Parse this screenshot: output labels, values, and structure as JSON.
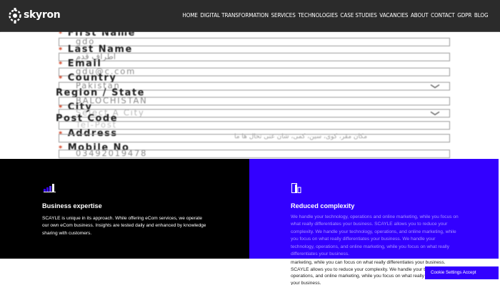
{
  "header": {
    "logo_text": "skyron",
    "nav": [
      "HOME",
      "DIGITAL TRANSFORMATION",
      "SERVICES",
      "TECHNOLOGIES",
      "CASE STUDIES",
      "VACANCIES",
      "ABOUT",
      "CONTACT",
      "GDPR",
      "BLOG"
    ]
  },
  "form": {
    "first_name_label": "First Name",
    "first_name_value": "gdo",
    "last_name_label": "Last Name",
    "last_name_value": "اطراف قدم",
    "email_label": "Email",
    "email_value": "gdu@c.com",
    "country_label": "Country",
    "country_value": "Pakistan",
    "region_label": "Region / State",
    "region_value": "BALOCHISTAN",
    "city_label": "City",
    "city_value": "Select A City",
    "postcode_label": "Post Code",
    "postcode_value": "Tel-Post",
    "address_label": "Address",
    "address_value": "مکان مقر، کوی، سین، کمی، شان عنی تحال ها ما",
    "mobile_label": "Mobile No",
    "mobile_value": "03492019478"
  },
  "features": {
    "left_title": "Business expertise",
    "left_text": "SCAYLE is unique in its approach. While offering eCom services, we operate our own eCom business. Insights are tested daily and enhanced by knowledge sharing with customers.",
    "right_title": "Reduced complexity",
    "right_text": "We handle your technology, operations and online marketing, while you focus on what really differentiates your business. SCAYLE allows you to reduce your complexity. We handle your technology, operations, and online marketing, while you focus on what really differentiates your business. We handle your technology, operations, and online marketing, while you focus on what really differentiates your business.",
    "right_overflow": "marketing, while you can focus on what really differentiates your business. SCAYLE allows you to reduce your complexity. We handle your technology, operations, and online marketing, while you focus on what really differentiates your business.",
    "cookie_text": "Cookie Settings Accept"
  },
  "colors": {
    "header_bg": "#2b2b2b",
    "accent_blue": "#3300ff",
    "panel_black": "#000000"
  }
}
